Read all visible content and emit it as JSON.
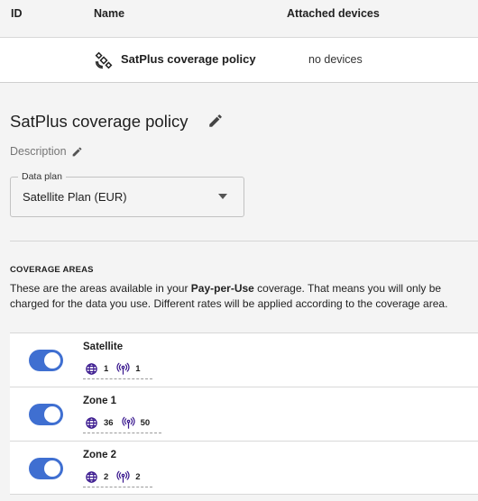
{
  "table": {
    "headers": {
      "id": "ID",
      "name": "Name",
      "devices": "Attached devices"
    },
    "row": {
      "name": "SatPlus coverage policy",
      "devices": "no devices",
      "icon": "satellite-icon"
    }
  },
  "detail": {
    "title": "SatPlus coverage policy",
    "description_label": "Description",
    "data_plan": {
      "label": "Data plan",
      "value": "Satellite Plan (EUR)"
    }
  },
  "coverage": {
    "heading": "COVERAGE AREAS",
    "text_before": "These are the areas available in your ",
    "text_bold": "Pay-per-Use",
    "text_after": " coverage. That means you will only be charged for the data you use. Different rates will be applied according to the coverage area.",
    "zones": [
      {
        "name": "Satellite",
        "countries": "1",
        "networks": "1",
        "enabled": true
      },
      {
        "name": "Zone 1",
        "countries": "36",
        "networks": "50",
        "enabled": true
      },
      {
        "name": "Zone 2",
        "countries": "2",
        "networks": "2",
        "enabled": true
      }
    ]
  },
  "colors": {
    "accent": "#3f6fd1",
    "icon_purple": "#3b1a8f"
  }
}
